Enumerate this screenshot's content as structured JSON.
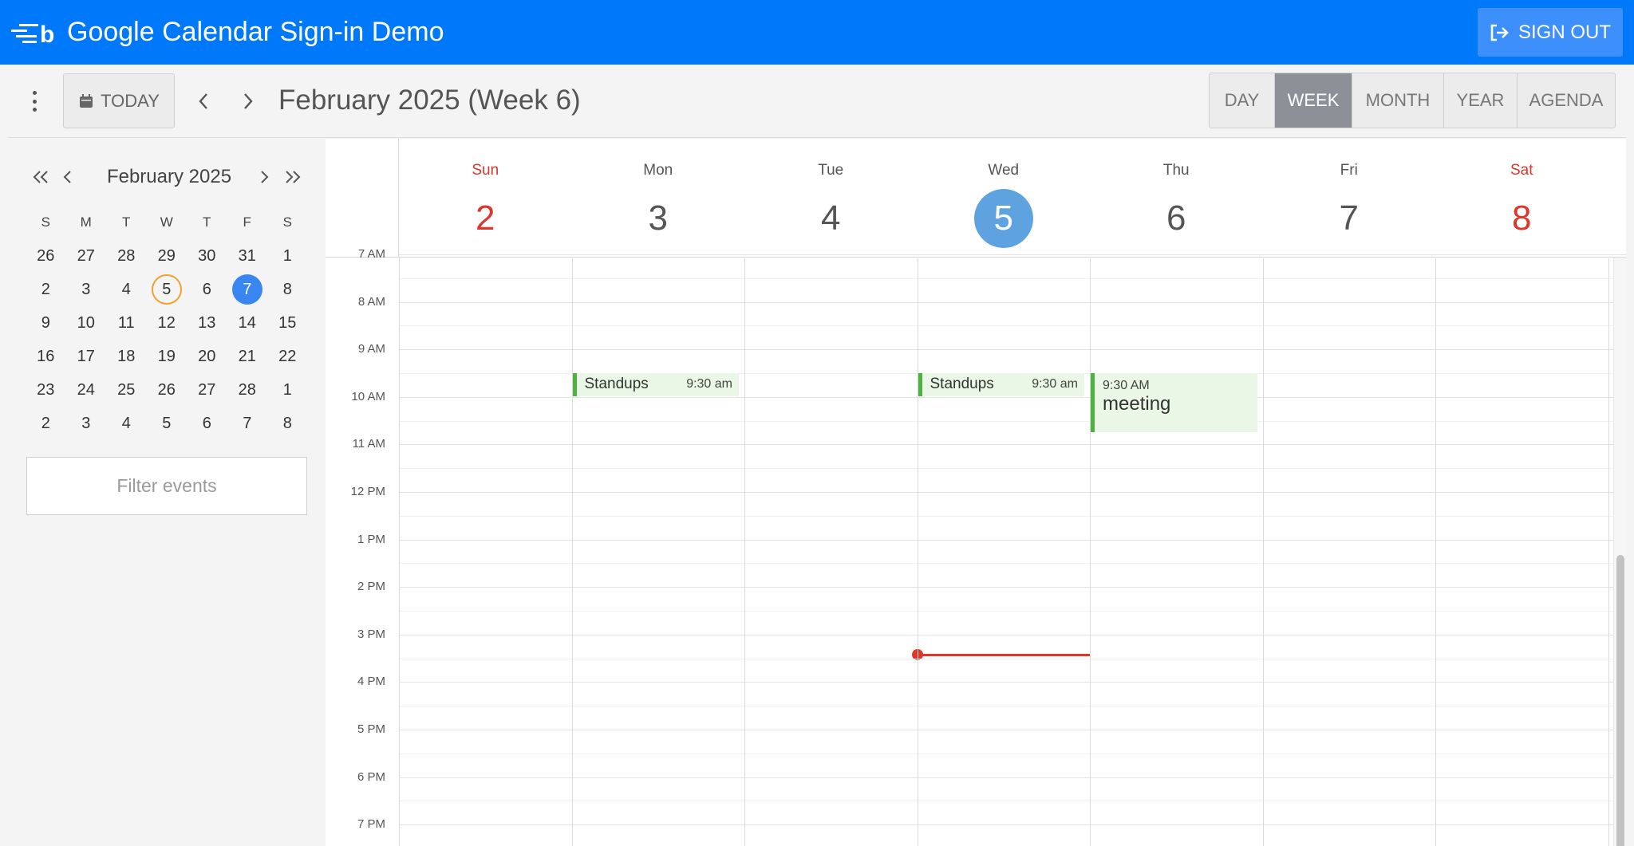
{
  "header": {
    "title": "Google Calendar Sign-in Demo",
    "signout_label": "SIGN OUT",
    "colors": {
      "bar": "#0078fa",
      "button": "#3d8ffc"
    }
  },
  "toolbar": {
    "today_label": "TODAY",
    "period_title": "February 2025 (Week 6)",
    "views": [
      "DAY",
      "WEEK",
      "MONTH",
      "YEAR",
      "AGENDA"
    ],
    "active_view": "WEEK"
  },
  "mini_calendar": {
    "title": "February 2025",
    "weekdays": [
      "S",
      "M",
      "T",
      "W",
      "T",
      "F",
      "S"
    ],
    "weeks": [
      [
        "26",
        "27",
        "28",
        "29",
        "30",
        "31",
        "1"
      ],
      [
        "2",
        "3",
        "4",
        "5",
        "6",
        "7",
        "8"
      ],
      [
        "9",
        "10",
        "11",
        "12",
        "13",
        "14",
        "15"
      ],
      [
        "16",
        "17",
        "18",
        "19",
        "20",
        "21",
        "22"
      ],
      [
        "23",
        "24",
        "25",
        "26",
        "27",
        "28",
        "1"
      ],
      [
        "2",
        "3",
        "4",
        "5",
        "6",
        "7",
        "8"
      ]
    ],
    "today": "5",
    "selected": "7"
  },
  "filter": {
    "placeholder": "Filter events"
  },
  "week": {
    "days": [
      {
        "name": "Sun",
        "num": "2"
      },
      {
        "name": "Mon",
        "num": "3"
      },
      {
        "name": "Tue",
        "num": "4"
      },
      {
        "name": "Wed",
        "num": "5"
      },
      {
        "name": "Thu",
        "num": "6"
      },
      {
        "name": "Fri",
        "num": "7"
      },
      {
        "name": "Sat",
        "num": "8"
      }
    ],
    "hours": [
      "7 AM",
      "8 AM",
      "9 AM",
      "10 AM",
      "11 AM",
      "12 PM",
      "1 PM",
      "2 PM",
      "3 PM",
      "4 PM",
      "5 PM",
      "6 PM",
      "7 PM"
    ]
  },
  "events": [
    {
      "title": "Standups",
      "time": "9:30 am",
      "day": "Mon"
    },
    {
      "title": "Standups",
      "time": "9:30 am",
      "day": "Wed"
    },
    {
      "title": "meeting",
      "time": "9:30 AM",
      "day": "Thu"
    }
  ],
  "colors": {
    "weekend": "#e0352b",
    "current_day": "#5ea3e0",
    "event_bar": "#4cb33f",
    "now_line": "#e0352b",
    "selected_day": "#3a86f0",
    "today_ring": "#f0a030"
  }
}
